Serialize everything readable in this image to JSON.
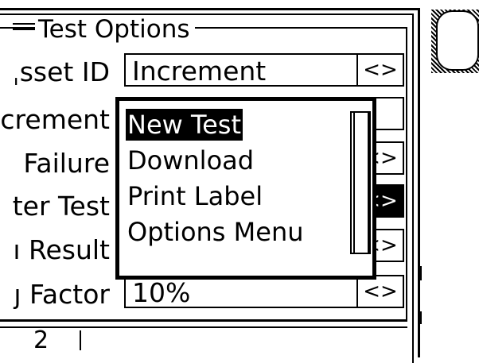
{
  "group_title": "Test Options",
  "rows": [
    {
      "label": "ˌsset ID",
      "value": "Increment",
      "spin": "<>"
    },
    {
      "label": "crement",
      "value": "",
      "spin": ""
    },
    {
      "label": "Failure",
      "value": "",
      "spin": "<>"
    },
    {
      "label": "ter Test",
      "value": "",
      "spin": "<>"
    },
    {
      "label": "ı Result",
      "value": "",
      "spin": "<>"
    },
    {
      "label": "ȷ Factor",
      "value": "10%",
      "spin": "<>"
    }
  ],
  "popup_menu": {
    "items": [
      "New Test",
      "Download",
      "Print Label",
      "Options Menu"
    ],
    "selected": "New Test"
  },
  "bottom_bar": {
    "cell_text": "2"
  }
}
